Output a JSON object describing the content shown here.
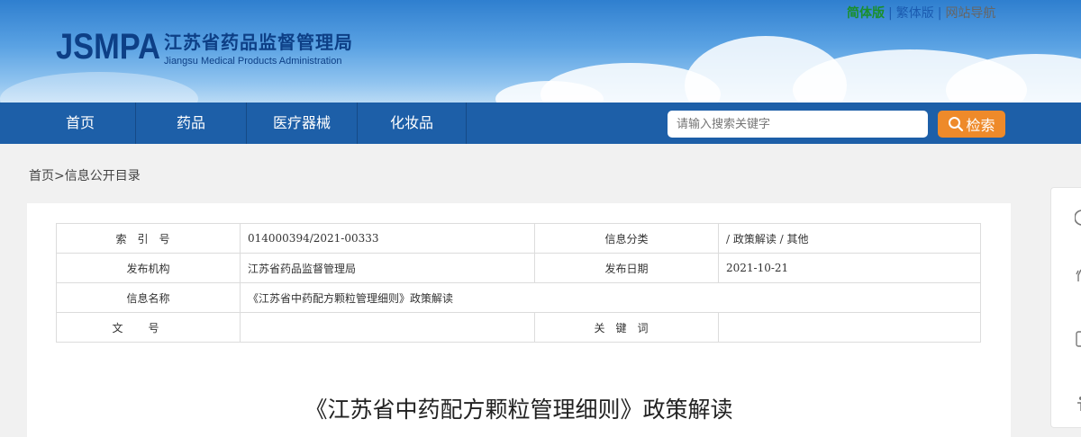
{
  "header": {
    "logo_abbr": "JSMPA",
    "logo_cn": "江苏省药品监督管理局",
    "logo_en": "Jiangsu Medical Products Administration",
    "top_links": [
      {
        "label": "简体版"
      },
      {
        "label": "繁体版"
      },
      {
        "label": "网站导航"
      }
    ],
    "separator": "|"
  },
  "nav": {
    "items": [
      {
        "label": "首页"
      },
      {
        "label": "药品"
      },
      {
        "label": "医疗器械"
      },
      {
        "label": "化妆品"
      }
    ],
    "search_placeholder": "请输入搜索关键字",
    "search_button": "检索",
    "search_icon": "magnifier-icon"
  },
  "breadcrumb": "首页>信息公开目录",
  "meta": {
    "index_label": "索引号",
    "index_value": "014000394/2021-00333",
    "category_label": "信息分类",
    "category_value": "/ 政策解读 / 其他",
    "publisher_label": "发布机构",
    "publisher_value": "江苏省药品监督管理局",
    "date_label": "发布日期",
    "date_value": "2021-10-21",
    "name_label": "信息名称",
    "name_value": "《江苏省中药配方颗粒管理细则》政策解读",
    "docno_label": "文号",
    "docno_value": "",
    "keyword_label": "关键词",
    "keyword_value": ""
  },
  "article": {
    "title": "《江苏省中药配方颗粒管理细则》政策解读"
  },
  "colors": {
    "nav_bg": "#1d5fa8",
    "search_button": "#ee8a2a",
    "logo": "#0d3f86",
    "simplified_link": "#1a8f2c"
  }
}
